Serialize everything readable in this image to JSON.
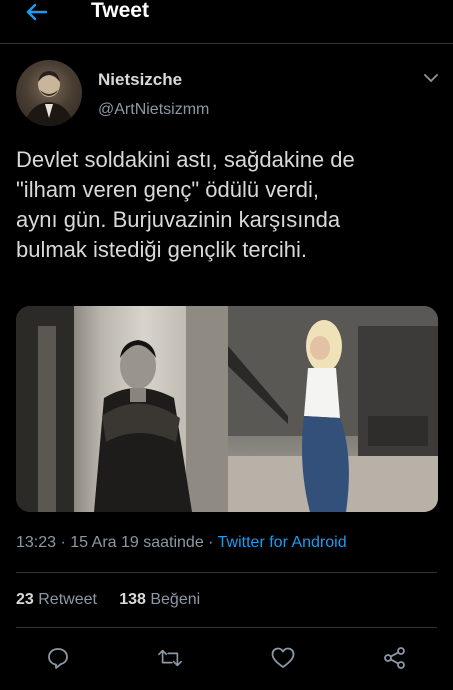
{
  "header": {
    "title": "Tweet",
    "back_icon": "arrow-left-icon",
    "accent": "#1d9bf0"
  },
  "author": {
    "name": "Nietsizche",
    "handle": "@ArtNietsizmm"
  },
  "tweet": {
    "text": "Devlet soldakini astı, sağdakine de\n\"ilham veren genç\" ödülü verdi,\naynı gün. Burjuvazinin karşısında\nbulmak istediği gençlik tercihi.",
    "media": [
      "black-and-white portrait of a young man",
      "young woman in a modern interior"
    ]
  },
  "meta": {
    "time": "13:23",
    "dot": "·",
    "date": "15 Ara 19 saatinde",
    "source": "Twitter for Android"
  },
  "stats": {
    "retweets": "23",
    "retweets_label": "Retweet",
    "likes": "138",
    "likes_label": "Beğeni"
  },
  "actions": [
    "reply-icon",
    "retweet-icon",
    "like-icon",
    "share-icon"
  ],
  "colors": {
    "background": "#000000",
    "text": "#d9d9d9",
    "secondary": "#8b98a5",
    "link": "#1d9bf0",
    "divider": "#2f3336"
  }
}
